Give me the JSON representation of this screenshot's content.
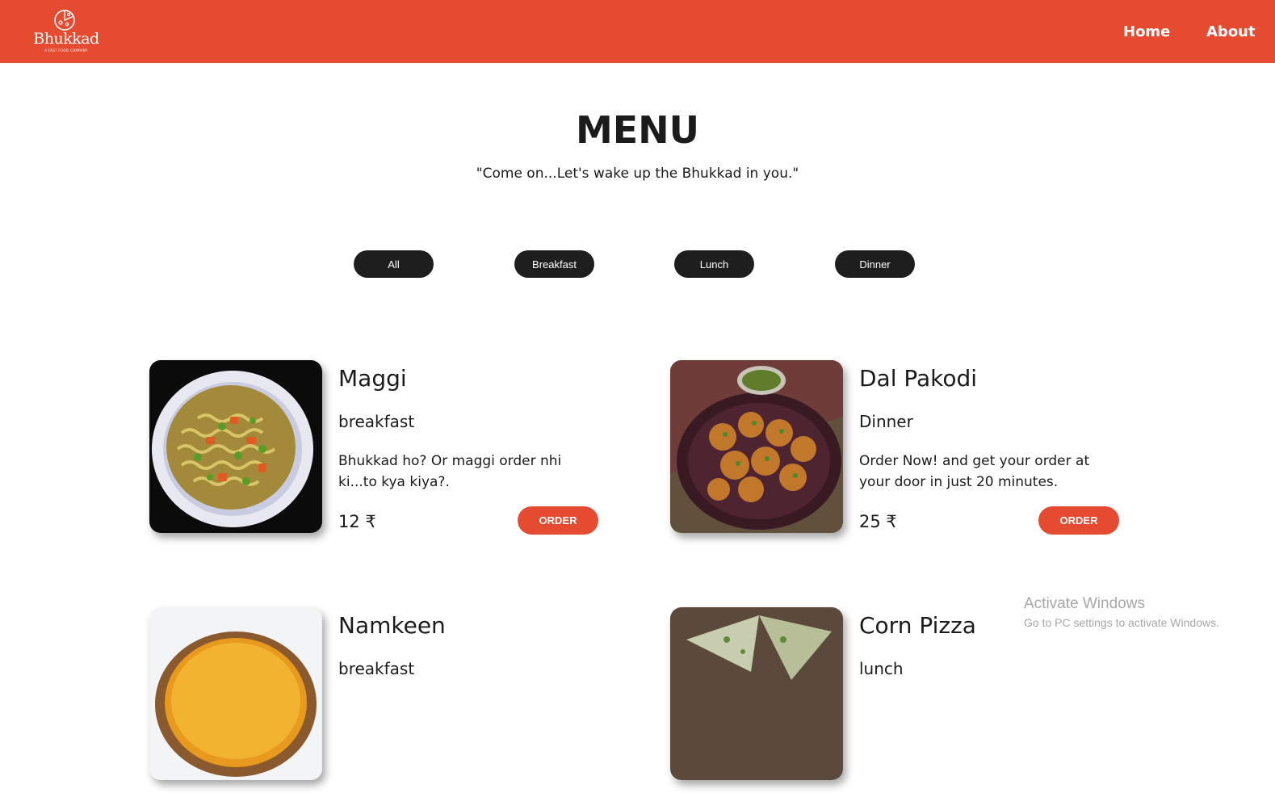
{
  "brand": {
    "name": "Bhukkad",
    "tagline": "A FAST FOOD COMPANY"
  },
  "nav": {
    "home": "Home",
    "about": "About"
  },
  "hero": {
    "title": "MENU",
    "subtitle": "\"Come on...Let's wake up the Bhukkad in you.\""
  },
  "filters": [
    "All",
    "Breakfast",
    "Lunch",
    "Dinner"
  ],
  "items": [
    {
      "name": "Maggi",
      "category": "breakfast",
      "description": "Bhukkad ho? Or maggi order nhi ki...to kya kiya?.",
      "price": "12 ₹",
      "order_label": "ORDER",
      "image_icon": "maggi-noodles-image"
    },
    {
      "name": "Dal Pakodi",
      "category": "Dinner",
      "description": "Order Now! and get your order at your door in just 20 minutes.",
      "price": "25 ₹",
      "order_label": "ORDER",
      "image_icon": "dal-pakodi-image"
    },
    {
      "name": "Namkeen",
      "category": "breakfast",
      "image_icon": "namkeen-image"
    },
    {
      "name": "Corn Pizza",
      "category": "lunch",
      "image_icon": "corn-pizza-image"
    }
  ],
  "os_watermark": {
    "title": "Activate Windows",
    "subtitle": "Go to PC settings to activate Windows."
  },
  "colors": {
    "brand": "#e44b30",
    "button_dark": "#1e1e1e",
    "text": "#1b1b1b"
  }
}
